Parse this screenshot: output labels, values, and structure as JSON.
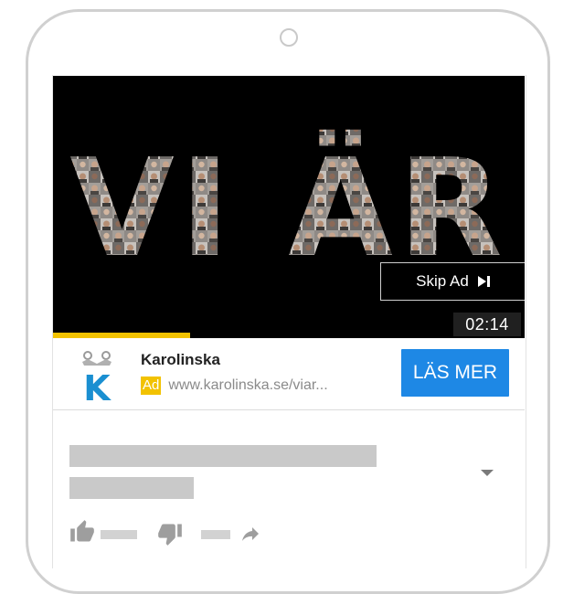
{
  "video": {
    "headline": "VI ÄR",
    "skip_label": "Skip Ad",
    "time_remaining": "02:14",
    "progress_percent": 29
  },
  "ad": {
    "advertiser": "Karolinska",
    "badge": "Ad",
    "url": "www.karolinska.se/viar...",
    "cta_label": "LÄS MER",
    "logo_letter": "K",
    "colors": {
      "cta": "#1e88e5",
      "badge": "#f2c200",
      "logo": "#1a8fd1"
    }
  },
  "icons": [
    "skip-next-icon",
    "crown-icon",
    "chevron-down-icon",
    "thumb-up-icon",
    "thumb-down-icon",
    "share-icon"
  ]
}
